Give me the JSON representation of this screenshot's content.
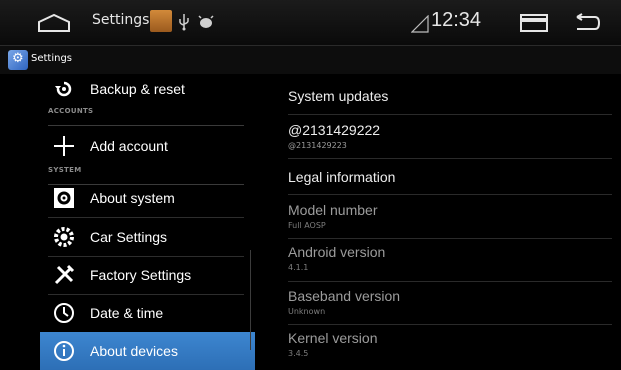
{
  "status_bar": {
    "title": "Settings",
    "time": "12:34",
    "icons": [
      "home-icon",
      "app-notification-icon",
      "usb-icon",
      "debug-icon",
      "signal-icon",
      "recent-apps-icon",
      "back-icon"
    ]
  },
  "action_bar": {
    "title": "Settings",
    "icon": "settings-app-icon"
  },
  "sidebar": {
    "items": [
      {
        "label": "Backup & reset",
        "icon": "backup-icon"
      },
      {
        "label": "Add account",
        "icon": "add-icon"
      },
      {
        "label": "About system",
        "icon": "about-system-icon"
      },
      {
        "label": "Car Settings",
        "icon": "car-settings-icon"
      },
      {
        "label": "Factory Settings",
        "icon": "factory-tools-icon"
      },
      {
        "label": "Date & time",
        "icon": "clock-icon"
      },
      {
        "label": "About devices",
        "icon": "info-icon",
        "selected": true
      }
    ],
    "sections": [
      "ACCOUNTS",
      "SYSTEM"
    ]
  },
  "details": {
    "items": [
      {
        "title": "System updates",
        "summary": ""
      },
      {
        "title": "@2131429222",
        "summary": "@2131429223"
      },
      {
        "title": "Legal information",
        "summary": ""
      },
      {
        "title": "Model number",
        "summary": "Full AOSP"
      },
      {
        "title": "Android version",
        "summary": "4.1.1"
      },
      {
        "title": "Baseband version",
        "summary": "Unknown"
      },
      {
        "title": "Kernel version",
        "summary": "3.4.5"
      }
    ]
  },
  "colors": {
    "selected_bg": "#3d86d0",
    "accent": "#33b5e5"
  }
}
